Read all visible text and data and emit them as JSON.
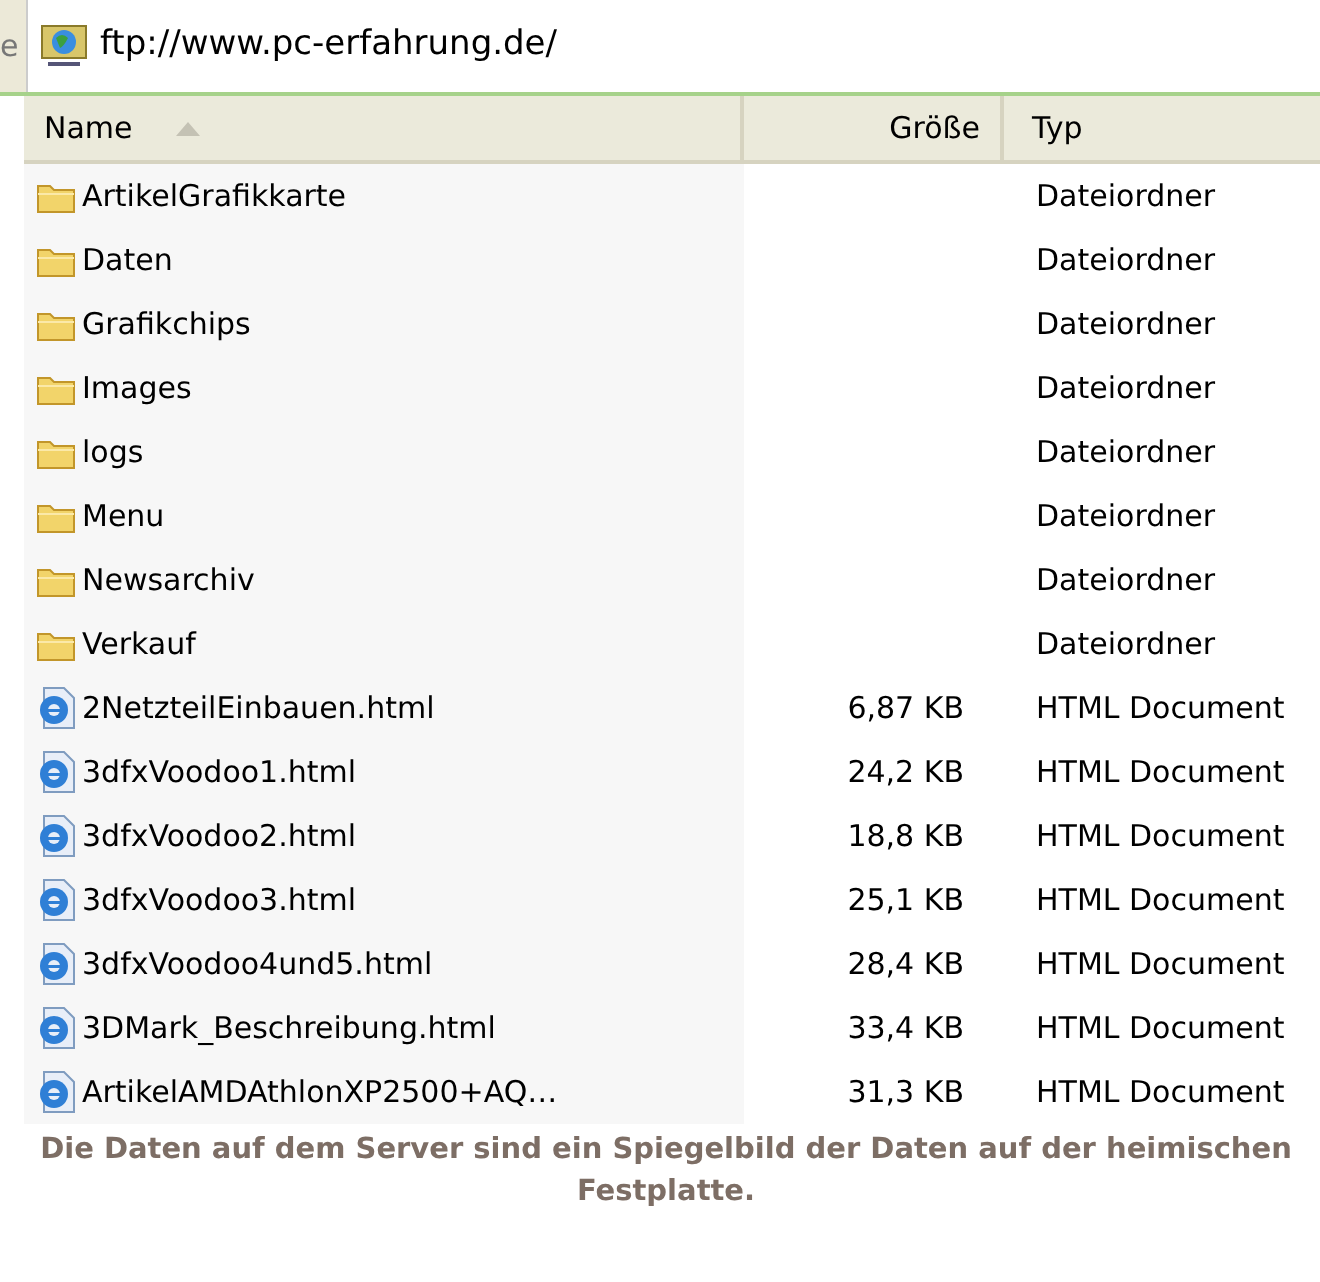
{
  "address_bar": {
    "label": "e",
    "url": "ftp://www.pc-erfahrung.de/"
  },
  "table": {
    "columns": [
      {
        "label": "Name",
        "sorted": true
      },
      {
        "label": "Größe",
        "sorted": false
      },
      {
        "label": "Typ",
        "sorted": false
      }
    ],
    "rows": [
      {
        "kind": "folder",
        "name": "ArtikelGrafikkarte",
        "size": "",
        "type": "Dateiordner"
      },
      {
        "kind": "folder",
        "name": "Daten",
        "size": "",
        "type": "Dateiordner"
      },
      {
        "kind": "folder",
        "name": "Grafikchips",
        "size": "",
        "type": "Dateiordner"
      },
      {
        "kind": "folder",
        "name": "Images",
        "size": "",
        "type": "Dateiordner"
      },
      {
        "kind": "folder",
        "name": "logs",
        "size": "",
        "type": "Dateiordner"
      },
      {
        "kind": "folder",
        "name": "Menu",
        "size": "",
        "type": "Dateiordner"
      },
      {
        "kind": "folder",
        "name": "Newsarchiv",
        "size": "",
        "type": "Dateiordner"
      },
      {
        "kind": "folder",
        "name": "Verkauf",
        "size": "",
        "type": "Dateiordner"
      },
      {
        "kind": "html",
        "name": "2NetzteilEinbauen.html",
        "size": "6,87 KB",
        "type": "HTML Document"
      },
      {
        "kind": "html",
        "name": "3dfxVoodoo1.html",
        "size": "24,2 KB",
        "type": "HTML Document"
      },
      {
        "kind": "html",
        "name": "3dfxVoodoo2.html",
        "size": "18,8 KB",
        "type": "HTML Document"
      },
      {
        "kind": "html",
        "name": "3dfxVoodoo3.html",
        "size": "25,1 KB",
        "type": "HTML Document"
      },
      {
        "kind": "html",
        "name": "3dfxVoodoo4und5.html",
        "size": "28,4 KB",
        "type": "HTML Document"
      },
      {
        "kind": "html",
        "name": "3DMark_Beschreibung.html",
        "size": "33,4 KB",
        "type": "HTML Document"
      },
      {
        "kind": "html",
        "name": "ArtikelAMDAthlonXP2500+AQ…",
        "size": "31,3 KB",
        "type": "HTML Document"
      }
    ]
  },
  "caption": "Die Daten auf dem Server sind ein Spiegelbild der Daten auf der heimischen Festplatte."
}
